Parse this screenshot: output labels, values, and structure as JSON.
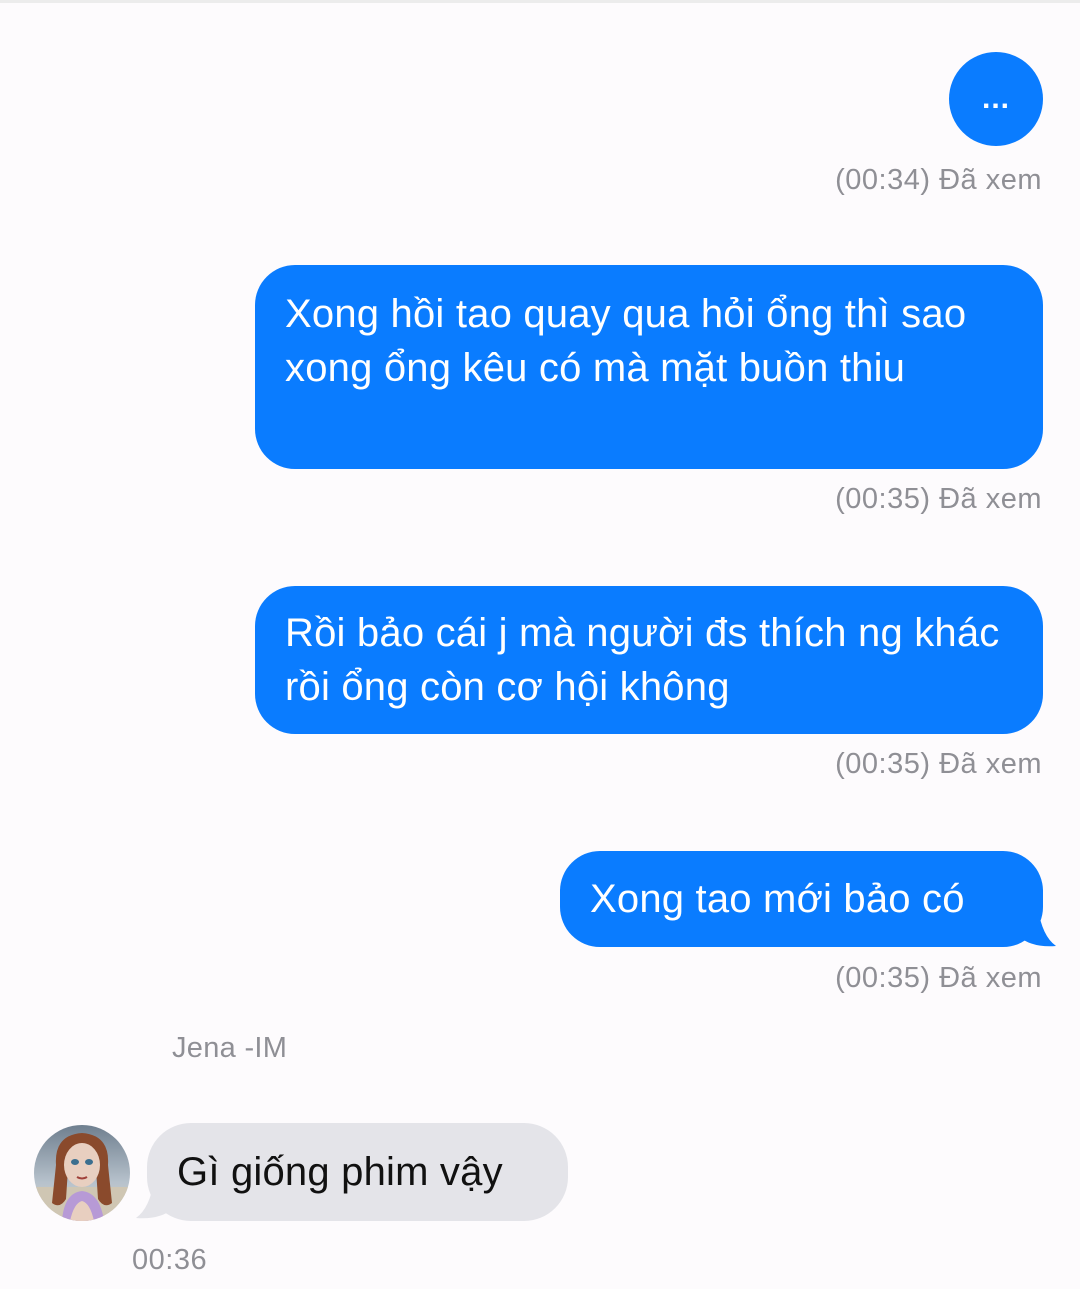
{
  "messages": [
    {
      "text": "...",
      "status": "(00:34) Đã xem"
    },
    {
      "text": "Xong hồi tao quay qua hỏi ổng thì sao xong ổng kêu có mà mặt buồn thiu",
      "status": "(00:35) Đã xem"
    },
    {
      "text": "Rồi bảo cái j mà người đs thích ng khác rồi ổng còn cơ hội không",
      "status": "(00:35) Đã xem"
    },
    {
      "text": "Xong tao mới bảo có",
      "status": "(00:35) Đã xem"
    }
  ],
  "incoming": {
    "sender_name": "Jena -IM",
    "text": "Gì giống phim vậy",
    "time": "00:36"
  },
  "colors": {
    "outgoing_bubble": "#0a7cff",
    "incoming_bubble": "#e4e4e9",
    "meta_text": "#8f8f95"
  }
}
